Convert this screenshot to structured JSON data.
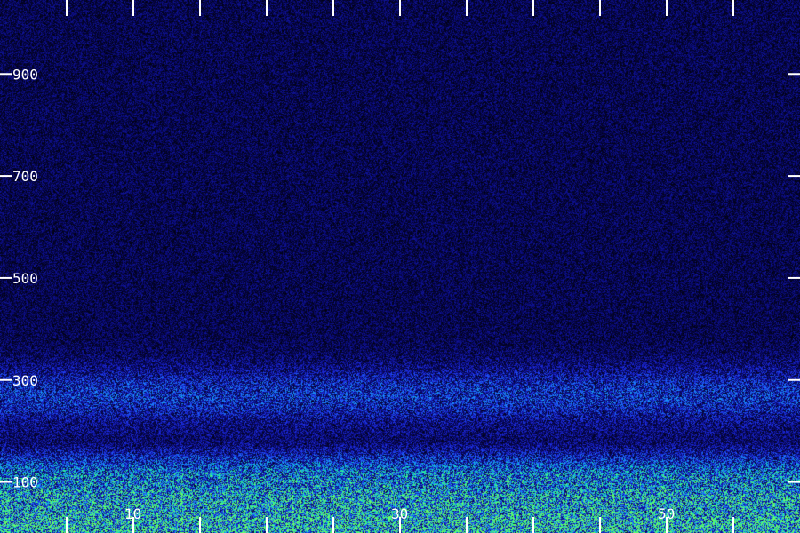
{
  "chart_data": {
    "type": "heatmap",
    "title": "",
    "xlabel": "",
    "ylabel": "",
    "y_labeled_ticks": [
      {
        "value": 900,
        "label": "900"
      },
      {
        "value": 700,
        "label": "700"
      },
      {
        "value": 500,
        "label": "500"
      },
      {
        "value": 300,
        "label": "300"
      },
      {
        "value": 100,
        "label": "100"
      }
    ],
    "x_labeled_ticks": [
      {
        "value": 10,
        "label": "10"
      },
      {
        "value": 30,
        "label": "30"
      },
      {
        "value": 50,
        "label": "50"
      }
    ],
    "x_minor_ticks": [
      5,
      15,
      20,
      25,
      35,
      40,
      45,
      55
    ],
    "xlim": [
      0,
      60
    ],
    "ylim": [
      0,
      1045
    ],
    "grid": false,
    "colormap": [
      "#000000",
      "#0a0a78",
      "#1e2ee6",
      "#1a8cff",
      "#10e6b4",
      "#66ff66"
    ],
    "intensity_profile": {
      "background": 0.18,
      "high_rows": [
        {
          "y": 270,
          "level": 0.45
        },
        {
          "y": 230,
          "level": 0.3
        },
        {
          "y": 100,
          "level": 0.7
        },
        {
          "y": 60,
          "level": 0.85
        },
        {
          "y": 20,
          "level": 0.95
        }
      ]
    },
    "axis_color": "#ffffff"
  }
}
